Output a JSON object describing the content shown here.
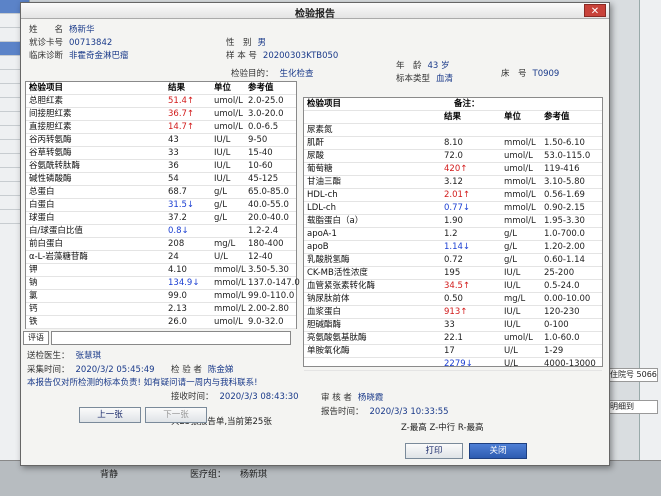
{
  "window": {
    "title": "检验报告",
    "close_glyph": "✕"
  },
  "patient": {
    "name_label": "姓　　名",
    "name": "杨新华",
    "card_label": "就诊卡号",
    "card": "00713842",
    "diag_label": "临床诊断",
    "diag": "非霍奇金淋巴瘤",
    "sex_label": "性　别",
    "sex": "男",
    "sample_label": "样 本 号",
    "sample": "20200303KTB050",
    "purpose_label": "检验目的：",
    "purpose": "生化检查",
    "age_label": "年　龄",
    "age": "43 岁",
    "type_label": "标本类型",
    "type": "血清",
    "bed_label": "床　号",
    "bed": "T0909"
  },
  "left_table": {
    "headers": {
      "item": "检验项目",
      "result": "结果",
      "unit": "单位",
      "ref": "参考值"
    },
    "rows": [
      {
        "name": "总胆红素",
        "result": "51.4↑",
        "flag": "up",
        "unit": "umol/L",
        "ref": "2.0-25.0"
      },
      {
        "name": "间接胆红素",
        "result": "36.7↑",
        "flag": "up",
        "unit": "umol/L",
        "ref": "3.0-20.0"
      },
      {
        "name": "直接胆红素",
        "result": "14.7↑",
        "flag": "up",
        "unit": "umol/L",
        "ref": "0.0-6.5"
      },
      {
        "name": "谷丙转氨酶",
        "result": "43",
        "flag": "",
        "unit": "IU/L",
        "ref": "9-50"
      },
      {
        "name": "谷草转氨酶",
        "result": "33",
        "flag": "",
        "unit": "IU/L",
        "ref": "15-40"
      },
      {
        "name": "谷氨酰转肽酶",
        "result": "36",
        "flag": "",
        "unit": "IU/L",
        "ref": "10-60"
      },
      {
        "name": "碱性磷酸酶",
        "result": "54",
        "flag": "",
        "unit": "IU/L",
        "ref": "45-125"
      },
      {
        "name": "总蛋白",
        "result": "68.7",
        "flag": "",
        "unit": "g/L",
        "ref": "65.0-85.0"
      },
      {
        "name": "白蛋白",
        "result": "31.5↓",
        "flag": "down",
        "unit": "g/L",
        "ref": "40.0-55.0"
      },
      {
        "name": "球蛋白",
        "result": "37.2",
        "flag": "",
        "unit": "g/L",
        "ref": "20.0-40.0"
      },
      {
        "name": "白/球蛋白比值",
        "result": "0.8↓",
        "flag": "down",
        "unit": "",
        "ref": "1.2-2.4"
      },
      {
        "name": "前白蛋白",
        "result": "208",
        "flag": "",
        "unit": "mg/L",
        "ref": "180-400"
      },
      {
        "name": "α-L-岩藻糖苷酶",
        "result": "24",
        "flag": "",
        "unit": "U/L",
        "ref": "12-40"
      },
      {
        "name": "钾",
        "result": "4.10",
        "flag": "",
        "unit": "mmol/L",
        "ref": "3.50-5.30"
      },
      {
        "name": "钠",
        "result": "134.9↓",
        "flag": "down",
        "unit": "mmol/L",
        "ref": "137.0-147.0"
      },
      {
        "name": "氯",
        "result": "99.0",
        "flag": "",
        "unit": "mmol/L",
        "ref": "99.0-110.0"
      },
      {
        "name": "钙",
        "result": "2.13",
        "flag": "",
        "unit": "mmol/L",
        "ref": "2.00-2.80"
      },
      {
        "name": "铁",
        "result": "26.0",
        "flag": "",
        "unit": "umol/L",
        "ref": "9.0-32.0"
      }
    ]
  },
  "right_table": {
    "headers": {
      "item": "检验项目",
      "note": "备注：",
      "result": "结果",
      "unit": "单位",
      "ref": "参考值"
    },
    "rows": [
      {
        "name": "尿素氮",
        "result": "",
        "flag": "",
        "unit": "",
        "ref": ""
      },
      {
        "name": "肌酐",
        "result": "8.10",
        "flag": "",
        "unit": "mmol/L",
        "ref": "1.50-6.10"
      },
      {
        "name": "尿酸",
        "result": "72.0",
        "flag": "",
        "unit": "umol/L",
        "ref": "53.0-115.0"
      },
      {
        "name": "葡萄糖",
        "result": "420↑",
        "flag": "up",
        "unit": "umol/L",
        "ref": "119-416"
      },
      {
        "name": "甘油三酯",
        "result": "3.12",
        "flag": "",
        "unit": "mmol/L",
        "ref": "3.10-5.80"
      },
      {
        "name": "HDL-ch",
        "result": "2.01↑",
        "flag": "up",
        "unit": "mmol/L",
        "ref": "0.56-1.69"
      },
      {
        "name": "LDL-ch",
        "result": "0.77↓",
        "flag": "down",
        "unit": "mmol/L",
        "ref": "0.90-2.15"
      },
      {
        "name": "载脂蛋白（a）",
        "result": "1.90",
        "flag": "",
        "unit": "mmol/L",
        "ref": "1.95-3.30"
      },
      {
        "name": "apoA-1",
        "result": "1.2",
        "flag": "",
        "unit": "g/L",
        "ref": "1.0-700.0"
      },
      {
        "name": "apoB",
        "result": "1.14↓",
        "flag": "down",
        "unit": "g/L",
        "ref": "1.20-2.00"
      },
      {
        "name": "乳酸脱氢酶",
        "result": "0.72",
        "flag": "",
        "unit": "g/L",
        "ref": "0.60-1.14"
      },
      {
        "name": "CK-MB活性浓度",
        "result": "195",
        "flag": "",
        "unit": "IU/L",
        "ref": "25-200"
      },
      {
        "name": "血管紧张素转化酶",
        "result": "34.5↑",
        "flag": "up",
        "unit": "IU/L",
        "ref": "0.5-24.0"
      },
      {
        "name": "钠尿肽前体",
        "result": "0.50",
        "flag": "",
        "unit": "mg/L",
        "ref": "0.00-10.00"
      },
      {
        "name": "血浆蛋白",
        "result": "913↑",
        "flag": "up",
        "unit": "IU/L",
        "ref": "120-230"
      },
      {
        "name": "胆碱酯酶",
        "result": "33",
        "flag": "",
        "unit": "IU/L",
        "ref": "0-100"
      },
      {
        "name": "亮氨酸氨基肽酶",
        "result": "22.1",
        "flag": "",
        "unit": "umol/L",
        "ref": "1.0-60.0"
      },
      {
        "name": "单胺氧化酶",
        "result": "17",
        "flag": "",
        "unit": "U/L",
        "ref": "1-29"
      },
      {
        "name": "",
        "result": "2279↓",
        "flag": "down",
        "unit": "U/L",
        "ref": "4000-13000"
      }
    ]
  },
  "remark": {
    "label": "评语"
  },
  "footer": {
    "doctor_label": "送检医生：",
    "doctor": "张慧琪",
    "collect_label": "采集时间：",
    "collect": "2020/3/2 05:45:49",
    "disclaimer": "本报告仅对所检测的标本负责! 如有疑问请一周内与我科联系!",
    "checker_label": "检 验 者",
    "checker": "陈金娣",
    "receive_label": "接收时间：",
    "receive": "2020/3/3 08:43:30",
    "reviewer_label": "审 核 者",
    "reviewer": "杨晓霞",
    "report_label": "报告时间：",
    "report": "2020/3/3 10:33:55",
    "legend": "Z-最高 Z-中行 R-最高",
    "count": "共25张报告单,当前第25张"
  },
  "buttons": {
    "prev": "上一张",
    "next": "下一张",
    "print": "打印",
    "close": "关闭"
  },
  "background": {
    "right_status": "住院号 5066",
    "right_dropdown": "明细到",
    "bottom_left": "背静",
    "bottom_mid_label": "医疗组：",
    "bottom_mid": "杨新琪"
  }
}
